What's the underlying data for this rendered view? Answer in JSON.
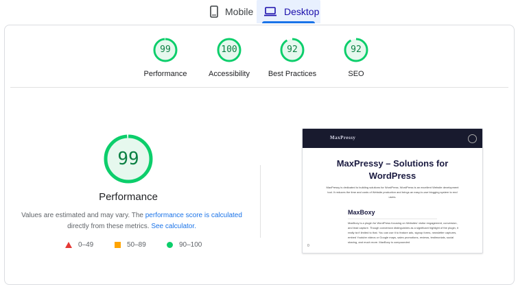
{
  "tabs": [
    {
      "label": "Mobile",
      "icon": "phone-icon",
      "active": false
    },
    {
      "label": "Desktop",
      "icon": "laptop-icon",
      "active": true
    }
  ],
  "summary": [
    {
      "score": "99",
      "label": "Performance",
      "fraction": 0.99
    },
    {
      "score": "100",
      "label": "Accessibility",
      "fraction": 1.0
    },
    {
      "score": "92",
      "label": "Best Practices",
      "fraction": 0.92
    },
    {
      "score": "92",
      "label": "SEO",
      "fraction": 0.92
    }
  ],
  "main": {
    "score": "99",
    "fraction": 0.99,
    "title": "Performance",
    "desc_prefix": "Values are estimated and may vary. The ",
    "desc_link1": "performance score is calculated",
    "desc_middle": " directly from these metrics. ",
    "desc_link2": "See calculator."
  },
  "legend": [
    {
      "icon": "red-triangle-icon",
      "label": "0–49"
    },
    {
      "icon": "orange-square-icon",
      "label": "50–89"
    },
    {
      "icon": "green-circle-icon",
      "label": "90–100"
    }
  ],
  "screenshot": {
    "logo": "MaxPressy",
    "title": "MaxPressy – Solutions for WordPress",
    "description": "MaxPressy is dedicated to building solutions for WordPress. WordPress is an excellent Website development tool. It reduces the time and costs of Website production and brings an easy-to-use blogging system to end users.",
    "section_title": "MaxBoxy",
    "section_body": "MaxBoxy is a plugin for WordPress focusing on Websites' visitor engagement, conversion, and lead capture. Though conversion distinguishes as a significant highlight of the plugin, it really isn't limited to that. You can use it to feature ads, signup forms, newsletter captures, embed Youtube videos or Google maps, sales promotions, reviews, testimonials, social sharing, and much more. MaxBoxy is compounded",
    "corner_text": "0"
  },
  "colors": {
    "pass_green": "#0cce6b",
    "pass_text": "#0b8043",
    "pass_bg": "#e6f8ee",
    "accent_blue": "#1a73e8"
  }
}
